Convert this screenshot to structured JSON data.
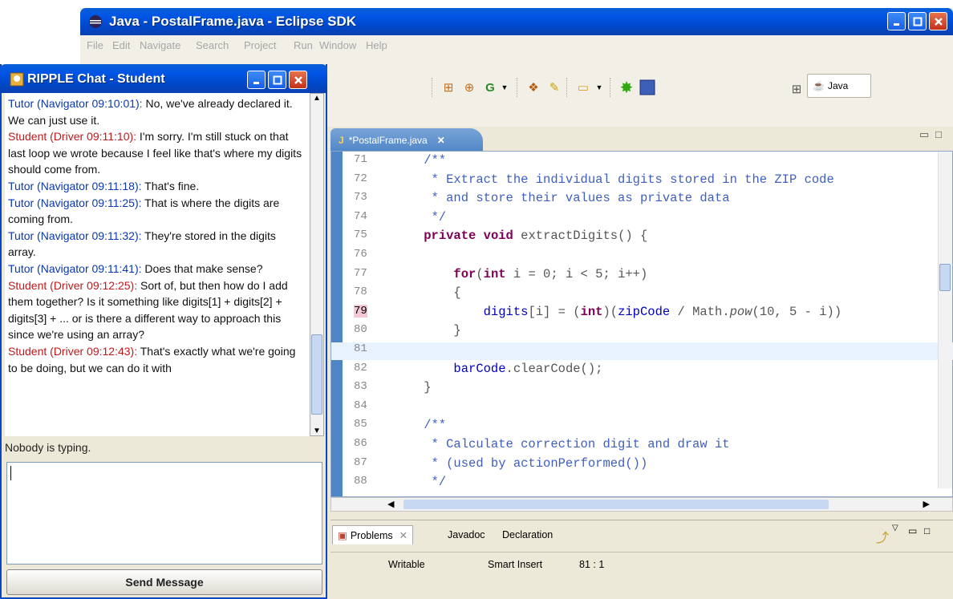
{
  "eclipse": {
    "title": "Java - PostalFrame.java - Eclipse SDK",
    "menu": [
      "File",
      "Edit",
      "Navigate",
      "Search",
      "Project",
      "Run",
      "Window",
      "Help"
    ],
    "perspective": "Java",
    "editor_tab": "*PostalFrame.java",
    "code": [
      {
        "n": "71",
        "t": "    /**"
      },
      {
        "n": "72",
        "t": "     * Extract the individual digits stored in the ZIP code"
      },
      {
        "n": "73",
        "t": "     * and store their values as private data"
      },
      {
        "n": "74",
        "t": "     */"
      },
      {
        "n": "75",
        "t": "    private void extractDigits() {"
      },
      {
        "n": "76",
        "t": ""
      },
      {
        "n": "77",
        "t": "        for(int i = 0; i < 5; i++)"
      },
      {
        "n": "78",
        "t": "        {"
      },
      {
        "n": "79",
        "t": "            digits[i] = (int)(zipCode / Math.pow(10, 5 - i))"
      },
      {
        "n": "80",
        "t": "        }"
      },
      {
        "n": "81",
        "t": ""
      },
      {
        "n": "82",
        "t": "        barCode.clearCode();"
      },
      {
        "n": "83",
        "t": "    }"
      },
      {
        "n": "84",
        "t": ""
      },
      {
        "n": "85",
        "t": "    /**"
      },
      {
        "n": "86",
        "t": "     * Calculate correction digit and draw it"
      },
      {
        "n": "87",
        "t": "     * (used by actionPerformed())"
      },
      {
        "n": "88",
        "t": "     */"
      }
    ],
    "panel_tabs": [
      "Problems",
      "Javadoc",
      "Declaration"
    ],
    "status": {
      "writable": "Writable",
      "insert": "Smart Insert",
      "position": "81 : 1"
    }
  },
  "chat": {
    "title": "RIPPLE Chat - Student",
    "messages": [
      {
        "role": "tutor",
        "who": "Tutor (Navigator 09:10:01):",
        "text": " No, we've already declared it.  We can just use it."
      },
      {
        "role": "student",
        "who": "Student (Driver 09:11:10):",
        "text": " I'm sorry.  I'm still stuck on that last loop we wrote because I feel like that's where my digits should come from."
      },
      {
        "role": "tutor",
        "who": "Tutor (Navigator 09:11:18):",
        "text": " That's fine."
      },
      {
        "role": "tutor",
        "who": "Tutor (Navigator 09:11:25):",
        "text": " That is where the digits are coming from."
      },
      {
        "role": "tutor",
        "who": "Tutor (Navigator 09:11:32):",
        "text": " They're stored in the digits array."
      },
      {
        "role": "tutor",
        "who": "Tutor (Navigator 09:11:41):",
        "text": " Does that make sense?"
      },
      {
        "role": "student",
        "who": "Student (Driver 09:12:25):",
        "text": " Sort of, but then how do I add them  together?  Is it something like digits[1] + digits[2] + digits[3] + ...  or is there a different way to approach this since we're using an array?"
      },
      {
        "role": "student",
        "who": "Student (Driver 09:12:43):",
        "text": " That's exactly what we're going to be doing, but we can do it with"
      }
    ],
    "typing_status": "Nobody is typing.",
    "send_label": "Send Message"
  }
}
